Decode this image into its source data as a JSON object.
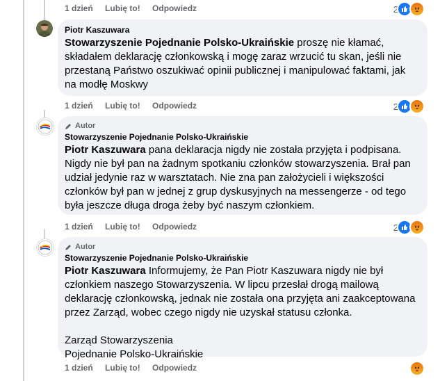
{
  "comments": [
    {
      "actions": {
        "time": "1 dzień",
        "like": "Lubię to!",
        "reply": "Odpowiedz"
      },
      "reactions": {
        "count": "2"
      }
    },
    {
      "author": "Piotr Kaszuwara",
      "mention": "Stowarzyszenie Pojednanie Polsko-Ukraińskie",
      "text": " proszę nie kłamać, składałem deklarację członkowską i mogę zaraz wrzucić tu skan, jeśli nie przestaną Państwo oszukiwać opinii publicznej i manipulować faktami, jak na modłę Moskwy",
      "actions": {
        "time": "1 dzień",
        "like": "Lubię to!",
        "reply": "Odpowiedz"
      },
      "reactions": {
        "count": "2"
      }
    },
    {
      "badge": "Autor",
      "author": "Stowarzyszenie Pojednanie Polsko-Ukraińskie",
      "mention": "Piotr Kaszuwara",
      "text": " pana deklaracja nigdy nie została przyjęta i podpisana. Nigdy nie był pan na żadnym spotkaniu członków stowarzyszenia. Brał pan udział jedynie raz w warsztatach. Nie zna pan założycieli i większości członków był pan w jednej z grup dyskusyjnych na messengerze - od tego była jeszcze długa droga żeby być naszym członkiem.",
      "actions": {
        "time": "1 dzień",
        "like": "Lubię to!",
        "reply": "Odpowiedz"
      },
      "reactions": {
        "count": "2"
      }
    },
    {
      "badge": "Autor",
      "author": "Stowarzyszenie Pojednanie Polsko-Ukraińskie",
      "mention": "Piotr Kaszuwara",
      "text": " Informujemy, że Pan Piotr Kaszuwara nigdy nie był członkiem naszego Stowarzyszenia. W lipcu przesłał drogą mailową deklarację członkowską, jednak nie została ona przyjęta ani zaakceptowana przez Zarząd, wobec czego nigdy nie uzyskał statusu członka.",
      "sign1": "Zarząd Stowarzyszenia",
      "sign2": "Pojednanie Polsko-Ukraińskie",
      "actions": {
        "time": "1 dzień",
        "like": "Lubię to!",
        "reply": "Odpowiedz"
      },
      "reactions": {
        "count": ""
      }
    }
  ],
  "colors": {
    "like": "#1877f2",
    "angry": "#f27a1a",
    "bubble": "#f0f2f5",
    "meta": "#65676b"
  },
  "icons": [
    "pencil-icon",
    "like-reaction-icon",
    "angry-reaction-icon"
  ]
}
